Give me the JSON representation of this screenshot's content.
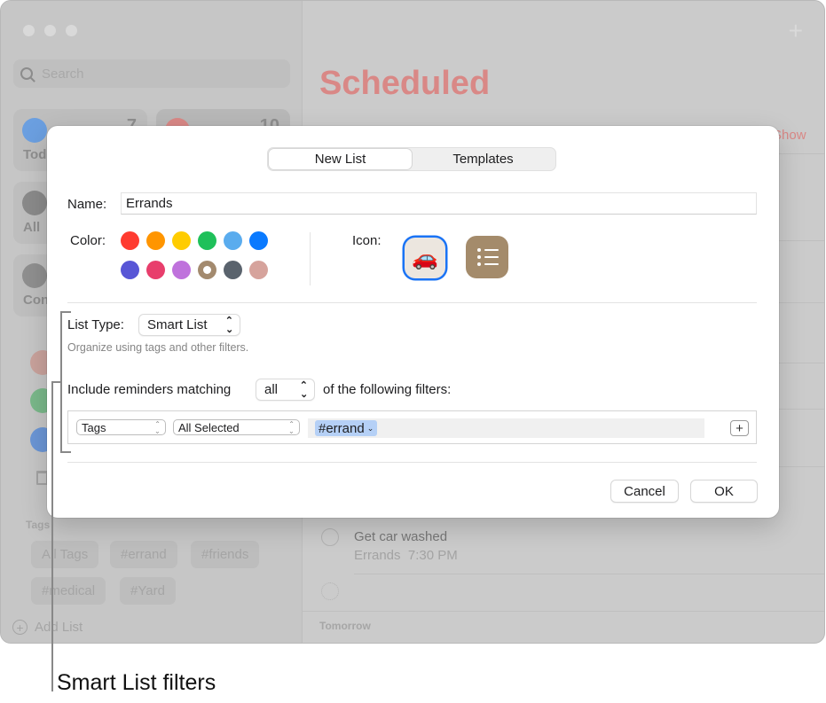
{
  "sidebar": {
    "search_placeholder": "Search",
    "smart_cards": [
      {
        "label": "Tod",
        "count": "7",
        "color": "#6b9fe0"
      },
      {
        "label": "",
        "count": "10",
        "color": "#d98886"
      },
      {
        "label": "All",
        "count": "",
        "color": "#8a8a8a"
      },
      {
        "label": "Con",
        "count": "",
        "color": "#8f8f8f"
      }
    ],
    "tags_heading": "Tags",
    "tags": [
      "All Tags",
      "#errand",
      "#friends",
      "#medical",
      "#Yard"
    ],
    "add_list_label": "Add List"
  },
  "main": {
    "title": "Scheduled",
    "show_link": "Show",
    "reminder": {
      "title": "Get car washed",
      "list": "Errands",
      "time": "7:30 PM"
    },
    "section_tomorrow": "Tomorrow",
    "accent_color": "#d98886"
  },
  "dialog": {
    "tabs": [
      {
        "label": "New List",
        "active": true
      },
      {
        "label": "Templates",
        "active": false
      }
    ],
    "name_label": "Name:",
    "name_value": "Errands",
    "color_label": "Color:",
    "colors": [
      "#ff3b30",
      "#ff9500",
      "#ffcc00",
      "#1fc05a",
      "#5aacee",
      "#0a7aff",
      "#5856d6",
      "#e83e6c",
      "#bf72dc",
      "#a38a6e",
      "#5a636d",
      "#d6a39c"
    ],
    "selected_color_index": 9,
    "icon_label": "Icon:",
    "icons": [
      {
        "name": "car-emoji",
        "glyph": "🚗",
        "selected": true
      },
      {
        "name": "list-bullet",
        "selected": false
      }
    ],
    "list_type_label": "List Type:",
    "list_type_value": "Smart List",
    "list_type_hint": "Organize using tags and other filters.",
    "include_prefix": "Include reminders matching",
    "match_value": "all",
    "include_suffix": "of the following filters:",
    "filter": {
      "field": "Tags",
      "mode": "All Selected",
      "token": "#errand",
      "add_label": "+"
    },
    "cancel_label": "Cancel",
    "ok_label": "OK"
  },
  "callout": {
    "label": "Smart List filters"
  }
}
